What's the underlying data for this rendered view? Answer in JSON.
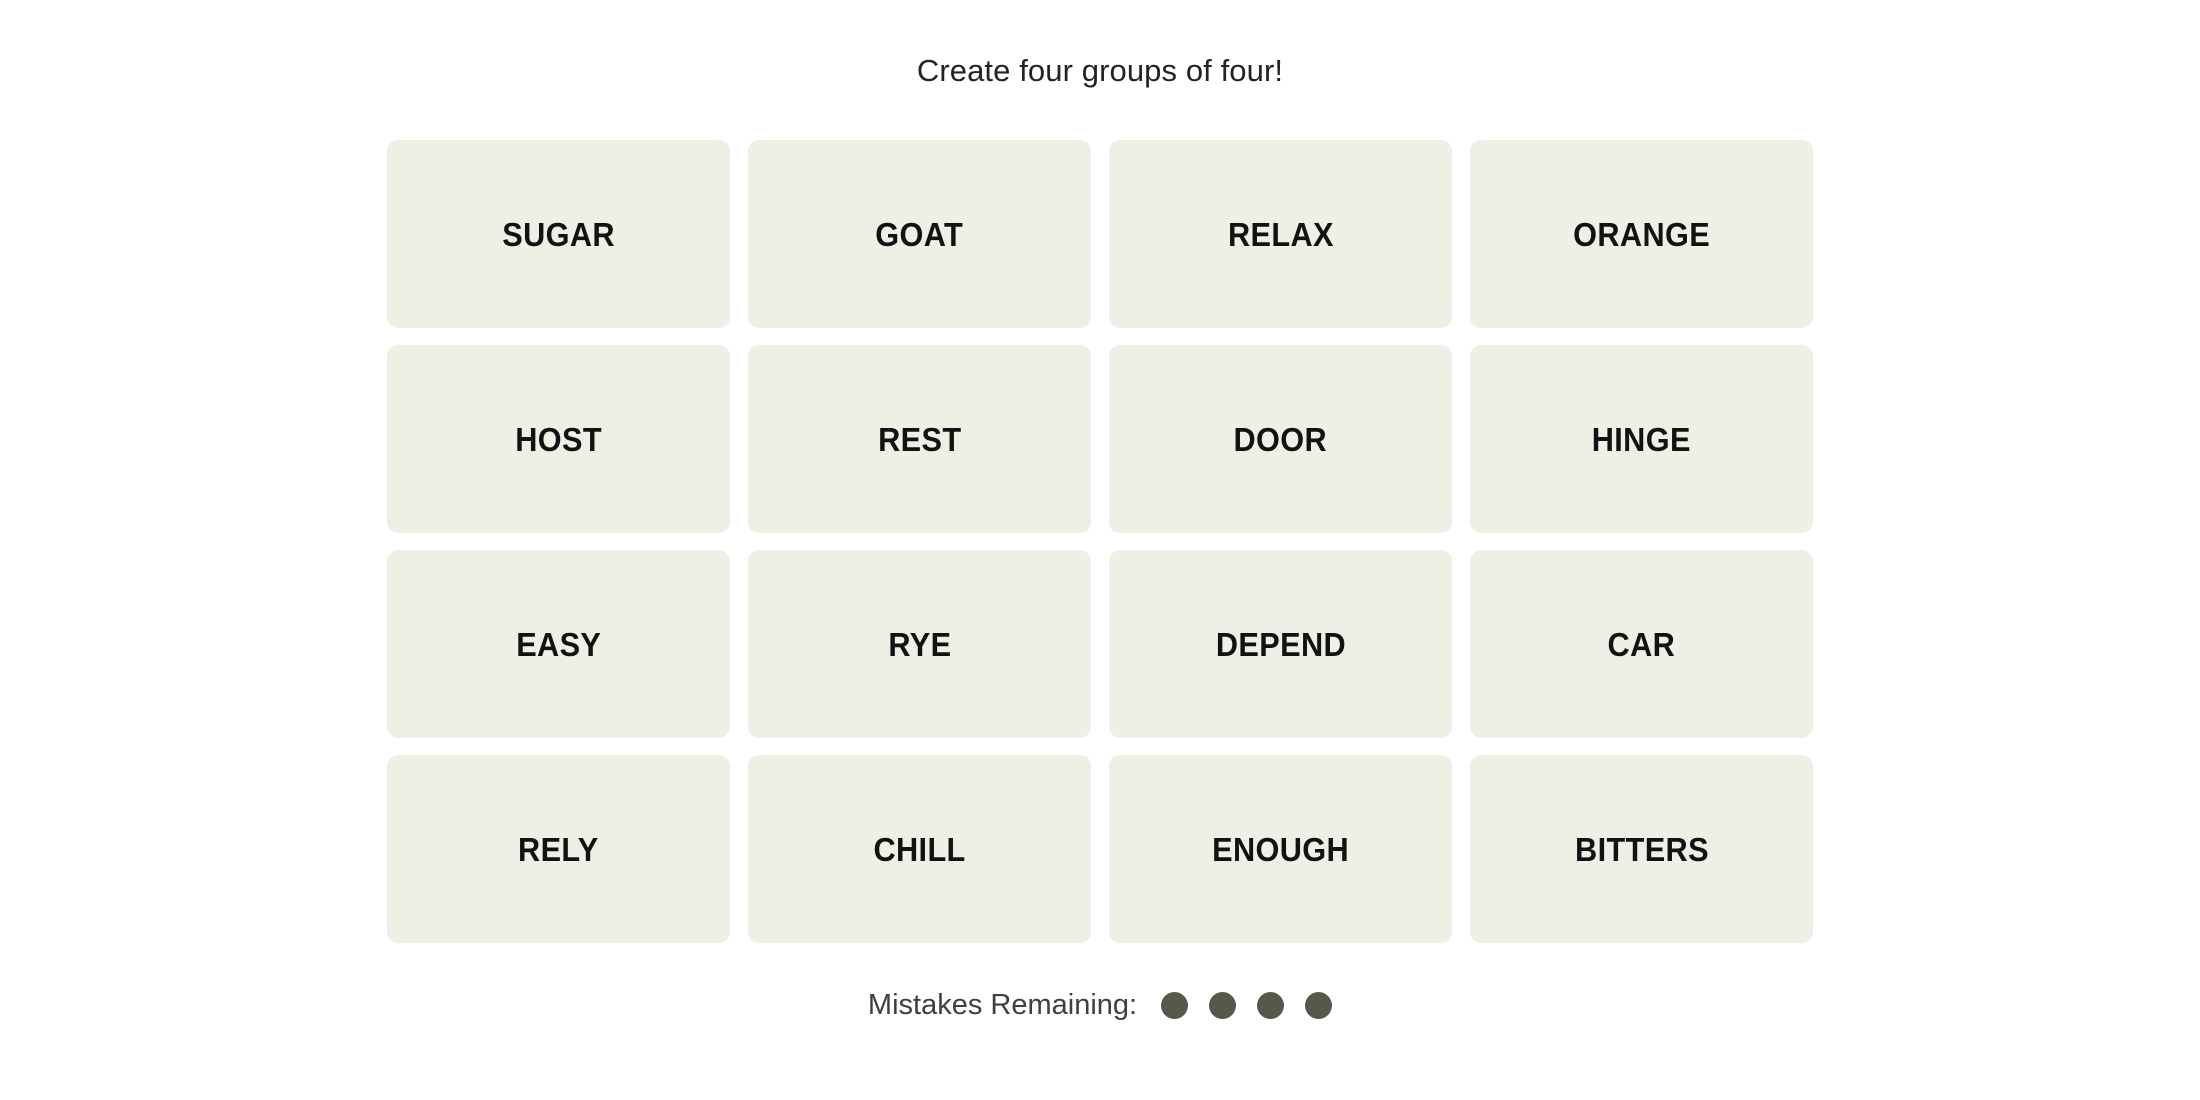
{
  "app": {
    "name": "Connections",
    "background_color": "#FFFFFF"
  },
  "header": {
    "instruction": "Create four groups of four!"
  },
  "board": {
    "rows": 4,
    "columns": 4,
    "tile_color": "#EFEFE6",
    "tile_text_color": "#121212",
    "tiles": [
      {
        "label": "SUGAR",
        "row": 1,
        "col": 1,
        "selected": false
      },
      {
        "label": "GOAT",
        "row": 1,
        "col": 2,
        "selected": false
      },
      {
        "label": "RELAX",
        "row": 1,
        "col": 3,
        "selected": false
      },
      {
        "label": "ORANGE",
        "row": 1,
        "col": 4,
        "selected": false
      },
      {
        "label": "HOST",
        "row": 2,
        "col": 1,
        "selected": false
      },
      {
        "label": "REST",
        "row": 2,
        "col": 2,
        "selected": false
      },
      {
        "label": "DOOR",
        "row": 2,
        "col": 3,
        "selected": false
      },
      {
        "label": "HINGE",
        "row": 2,
        "col": 4,
        "selected": false
      },
      {
        "label": "EASY",
        "row": 3,
        "col": 1,
        "selected": false
      },
      {
        "label": "RYE",
        "row": 3,
        "col": 2,
        "selected": false
      },
      {
        "label": "DEPEND",
        "row": 3,
        "col": 3,
        "selected": false
      },
      {
        "label": "CAR",
        "row": 3,
        "col": 4,
        "selected": false
      },
      {
        "label": "RELY",
        "row": 4,
        "col": 1,
        "selected": false
      },
      {
        "label": "CHILL",
        "row": 4,
        "col": 2,
        "selected": false
      },
      {
        "label": "ENOUGH",
        "row": 4,
        "col": 3,
        "selected": false
      },
      {
        "label": "BITTERS",
        "row": 4,
        "col": 4,
        "selected": false
      }
    ]
  },
  "footer": {
    "mistakes_label": "Mistakes Remaining:",
    "mistakes_remaining": 4,
    "dot_color": "#57574A",
    "dots": [
      {
        "state": "remaining"
      },
      {
        "state": "remaining"
      },
      {
        "state": "remaining"
      },
      {
        "state": "remaining"
      }
    ]
  }
}
